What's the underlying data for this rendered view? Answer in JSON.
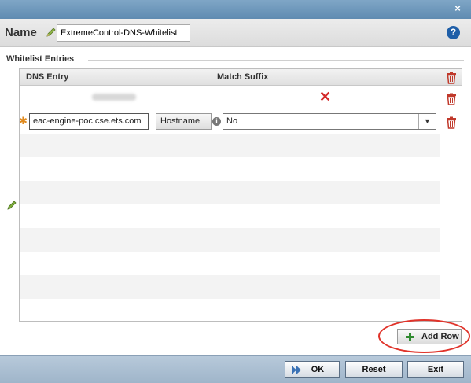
{
  "dialog": {
    "close_glyph": "×",
    "name_label": "Name",
    "name_value": "ExtremeControl-DNS-Whitelist",
    "help_glyph": "?"
  },
  "whitelist": {
    "section_title": "Whitelist Entries",
    "columns": [
      "DNS Entry",
      "Match Suffix"
    ],
    "rows": [
      {
        "dns_entry": "",
        "match_suffix_icon": "red-x-icon",
        "editing": false
      },
      {
        "dns_entry": "eac-engine-poc.cse.ets.com",
        "hostname_label": "Hostname",
        "info_glyph": "i",
        "match_suffix": "No",
        "editing": true
      }
    ],
    "empty_row_count": 8,
    "add_row_label": "Add Row"
  },
  "footer": {
    "ok_label": "OK",
    "reset_label": "Reset",
    "exit_label": "Exit"
  },
  "colors": {
    "titlebar": "#6f98bc",
    "footer": "#aabfd3",
    "delete_icon": "#c0392b",
    "highlight": "#e0332a",
    "required_star": "#e08a1e"
  }
}
